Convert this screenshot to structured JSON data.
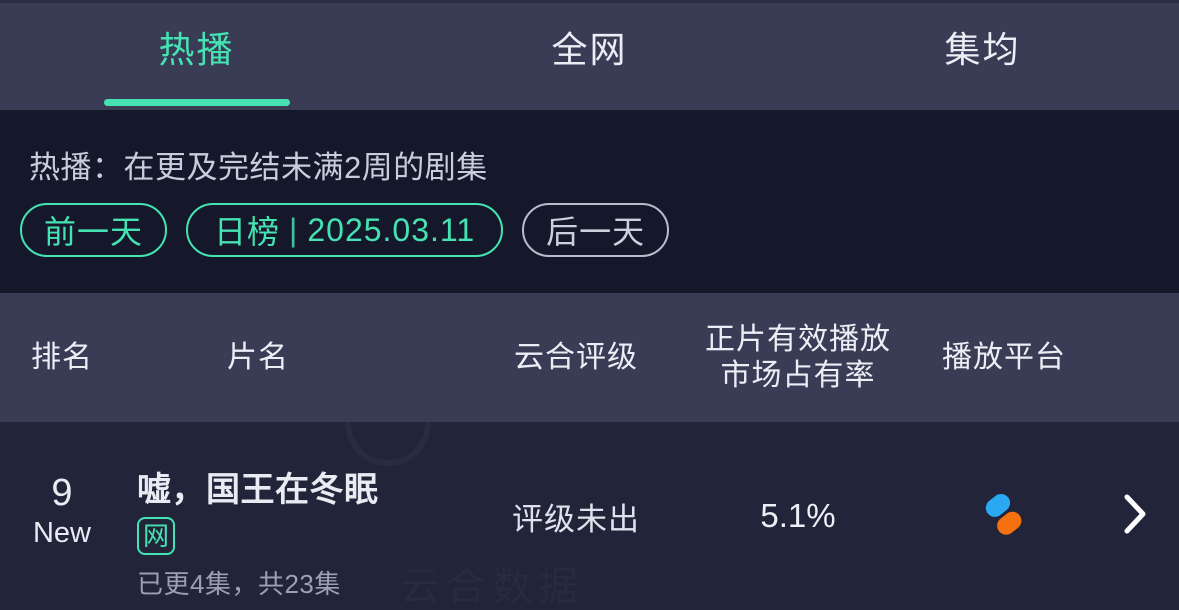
{
  "app": {
    "background_color": "#22243a",
    "accent_color": "#45e3b2",
    "panel_color": "#3a3c55",
    "filter_background_color": "#15182a"
  },
  "tabs": [
    {
      "label": "热播",
      "active": true
    },
    {
      "label": "全网",
      "active": false
    },
    {
      "label": "集均",
      "active": false
    }
  ],
  "filter": {
    "description": "热播：在更及完结未满2周的剧集",
    "prev_day_label": "前一天",
    "date_scope_label": "日榜",
    "date_separator": "|",
    "date_value": "2025.03.11",
    "next_day_label": "后一天"
  },
  "table": {
    "columns": [
      {
        "key": "rank",
        "label": "排名"
      },
      {
        "key": "title",
        "label": "片名"
      },
      {
        "key": "rating",
        "label": "云合评级"
      },
      {
        "key": "share",
        "label": "正片有效播放\n市场占有率"
      },
      {
        "key": "platform",
        "label": "播放平台"
      }
    ],
    "rows": [
      {
        "rank": "9",
        "rank_tag": "New",
        "title": "嘘，国王在冬眠",
        "badge": "网",
        "subtitle": "已更4集，共23集",
        "rating": "评级未出",
        "share": "5.1%",
        "platform_icon": "youku-logo",
        "chevron_icon": "chevron-right-icon"
      }
    ]
  },
  "watermark": {
    "text": "云合数据"
  }
}
